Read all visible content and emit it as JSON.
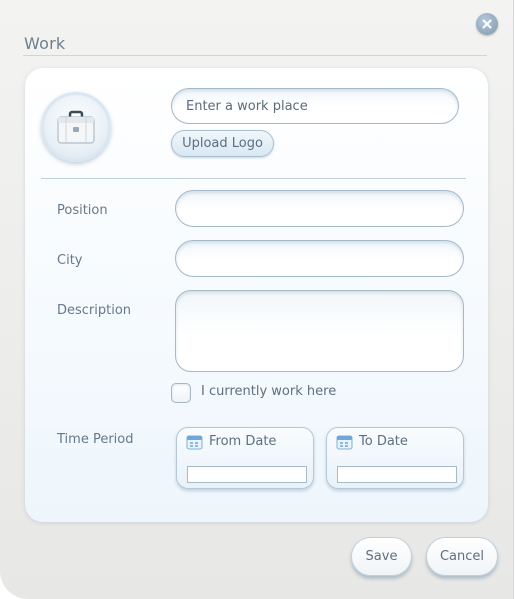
{
  "dialog": {
    "title": "Work"
  },
  "workplace": {
    "placeholder": "Enter a work place",
    "upload_logo_label": "Upload Logo",
    "logo_icon": "briefcase-icon"
  },
  "fields": {
    "position_label": "Position",
    "city_label": "City",
    "description_label": "Description",
    "position_value": "",
    "city_value": "",
    "description_value": ""
  },
  "current_job": {
    "label": "I currently work here",
    "checked": false
  },
  "time_period": {
    "label": "Time Period",
    "from_label": "From Date",
    "to_label": "To Date",
    "from_value": "",
    "to_value": "",
    "icon": "calendar-icon"
  },
  "actions": {
    "save_label": "Save",
    "cancel_label": "Cancel"
  },
  "colors": {
    "accent": "#7e98ad",
    "field_border": "#a5b9c8",
    "text": "#5d7080"
  }
}
